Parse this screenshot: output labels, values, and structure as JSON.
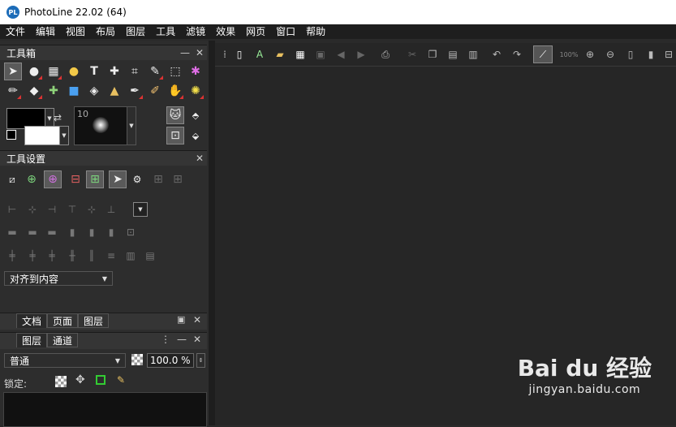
{
  "window": {
    "title": "PhotoLine 22.02 (64)",
    "app_icon_text": "PL"
  },
  "menu": [
    "文件",
    "编辑",
    "视图",
    "布局",
    "图层",
    "工具",
    "滤镜",
    "效果",
    "网页",
    "窗口",
    "帮助"
  ],
  "toolbox": {
    "title": "工具箱",
    "brush_size": "10"
  },
  "tool_settings": {
    "title": "工具设置",
    "align_dropdown": "对齐到内容"
  },
  "doc_tabs": [
    "文档",
    "页面",
    "图层"
  ],
  "layers_panel": {
    "tabs": [
      "图层",
      "通道"
    ],
    "blend_mode": "普通",
    "opacity": "100.0 %",
    "lock_label": "锁定:"
  },
  "toolbar": {
    "zoom": "100%"
  },
  "watermark": {
    "brand": "Bai du 经验",
    "url": "jingyan.baidu.com"
  },
  "colors": {
    "foreground": "#000000",
    "background": "#ffffff",
    "accent": "#1c6cb8"
  }
}
